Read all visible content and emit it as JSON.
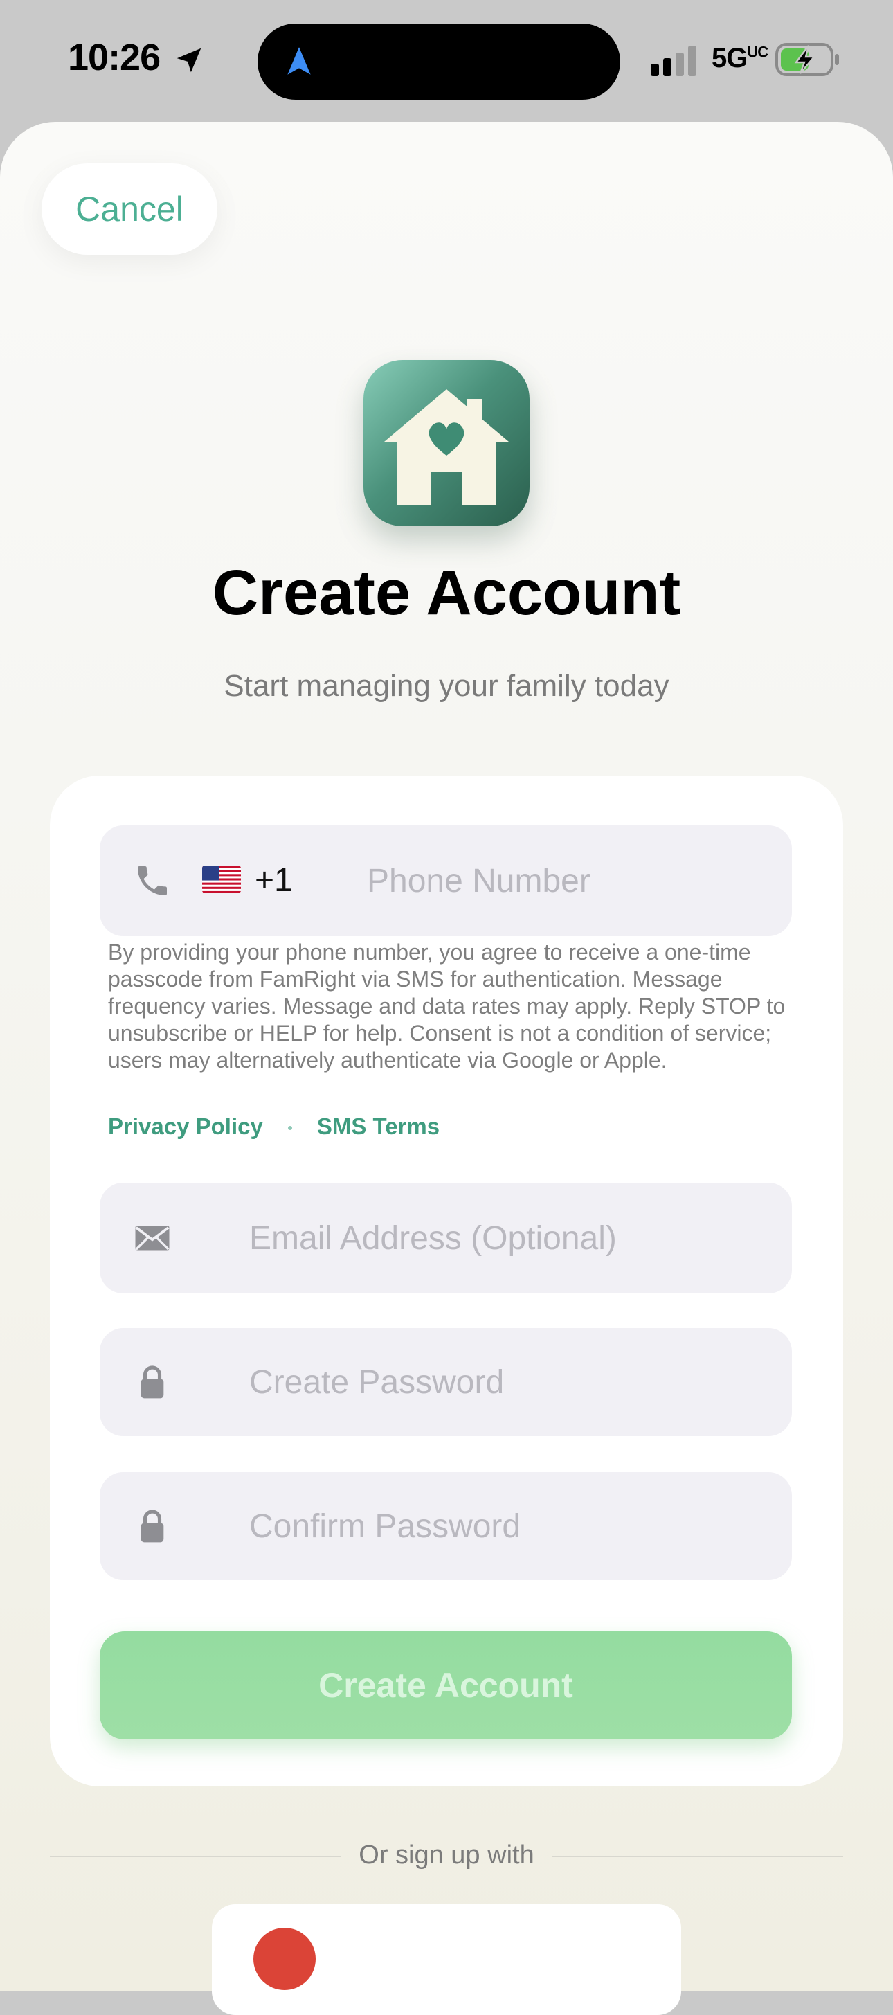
{
  "status_bar": {
    "time": "10:26",
    "network": "5G",
    "network_suffix": "UC"
  },
  "header": {
    "cancel_label": "Cancel"
  },
  "app": {
    "icon": "house-heart-icon",
    "title": "Create Account",
    "subtitle": "Start managing your family today"
  },
  "form": {
    "phone": {
      "country_code": "+1",
      "flag": "us-flag-icon",
      "placeholder": "Phone Number",
      "value": ""
    },
    "consent_text": "By providing your phone number, you agree to receive a one-time passcode from FamRight via SMS for authentication. Message frequency varies. Message and data rates may apply. Reply STOP to unsubscribe or HELP for help. Consent is not a condition of service; users may alternatively authenticate via Google or Apple.",
    "links": {
      "privacy_policy": "Privacy Policy",
      "sms_terms": "SMS Terms"
    },
    "email": {
      "placeholder": "Email Address (Optional)",
      "value": ""
    },
    "password": {
      "placeholder": "Create Password",
      "value": ""
    },
    "confirm_password": {
      "placeholder": "Confirm Password",
      "value": ""
    },
    "submit_label": "Create Account"
  },
  "divider_text": "Or sign up with",
  "colors": {
    "accent": "#4caf93",
    "link": "#3f9c7f",
    "button_disabled": "#9edfa6",
    "field_background": "#f1f0f5"
  }
}
